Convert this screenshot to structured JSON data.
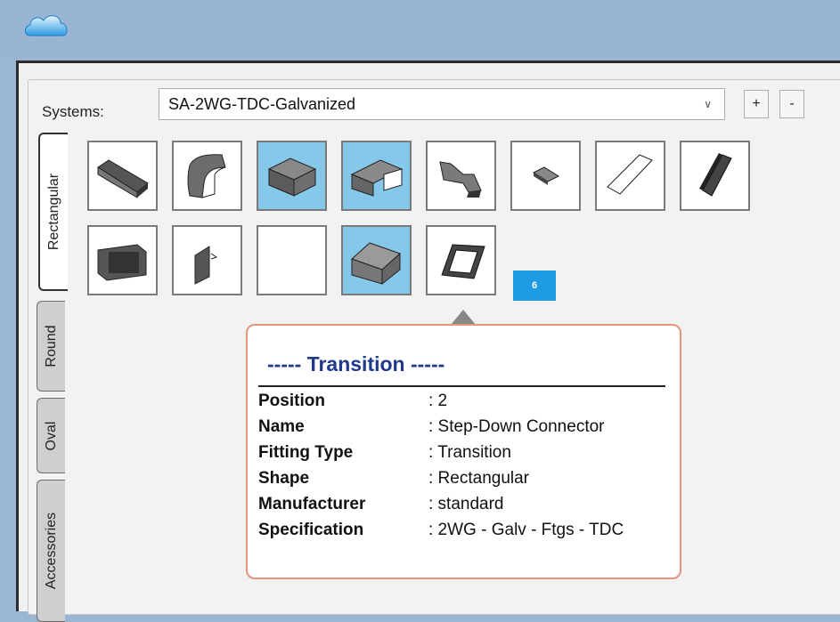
{
  "systems": {
    "label": "Systems:",
    "selected": "SA-2WG-TDC-Galvanized",
    "add_label": "+",
    "remove_label": "-"
  },
  "tabs": [
    {
      "label": "Rectangular",
      "active": true
    },
    {
      "label": "Round",
      "active": false
    },
    {
      "label": "Oval",
      "active": false
    },
    {
      "label": "Accessories",
      "active": false
    }
  ],
  "palette": {
    "row1": [
      "straight-duct-icon",
      "elbow-icon",
      "tee-icon",
      "transition-icon",
      "offset-icon",
      "cap-icon",
      "panel-icon",
      "damper-icon"
    ],
    "row2": [
      "grille-icon",
      "plate-icon",
      "blank-icon",
      "box-icon",
      "frame-icon"
    ],
    "selected": [
      "tee-icon",
      "transition-icon",
      "box-icon"
    ]
  },
  "badge": "6",
  "tooltip": {
    "title": "----- Transition -----",
    "rows": [
      {
        "key": "Position",
        "value": ": 2"
      },
      {
        "key": "Name",
        "value": ": Step-Down Connector"
      },
      {
        "key": "Fitting Type",
        "value": ": Transition"
      },
      {
        "key": "Shape",
        "value": ": Rectangular"
      },
      {
        "key": "Manufacturer",
        "value": ": standard"
      },
      {
        "key": "Specification",
        "value": ": 2WG - Galv - Ftgs - TDC"
      }
    ]
  },
  "colors": {
    "titlebar": "#9ab5d3",
    "selected_tile": "#86c8ea",
    "tooltip_border": "#e5957e",
    "tooltip_title": "#1f3a8a",
    "badge": "#1e9be2"
  }
}
